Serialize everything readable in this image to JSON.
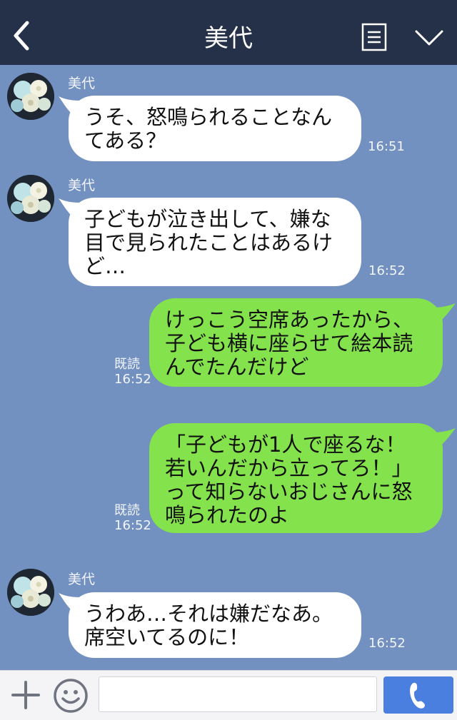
{
  "header": {
    "title": "美代"
  },
  "messages": [
    {
      "dir": "in",
      "sender": "美代",
      "text": "うそ、怒鳴られることなん\nてある？",
      "time": "16:51"
    },
    {
      "dir": "in",
      "sender": "美代",
      "text": "子どもが泣き出して、嫌な\n目で見られたことはあるけ\nど…",
      "time": "16:52"
    },
    {
      "dir": "out",
      "read": "既読",
      "text": "けっこう空席あったから、\n子ども横に座らせて絵本読\nんでたんだけど",
      "time": "16:52"
    },
    {
      "dir": "out",
      "read": "既読",
      "text": "「子どもが1人で座るな！\n若いんだから立ってろ！」\nって知らないおじさんに怒\n鳴られたのよ",
      "time": "16:52"
    },
    {
      "dir": "in",
      "sender": "美代",
      "text": "うわあ…それは嫌だなあ。\n席空いてるのに！",
      "time": "16:52"
    }
  ],
  "footer": {
    "input_value": ""
  },
  "colors": {
    "header_bg": "#253049",
    "chat_bg": "#7291c0",
    "incoming_bubble": "#ffffff",
    "outgoing_bubble": "#84e34c",
    "call_button": "#4a7fe0"
  },
  "icons": {
    "back": "chevron-left-icon",
    "menu": "notes-icon",
    "collapse": "chevron-down-icon",
    "add": "plus-icon",
    "emoji": "smiley-icon",
    "call": "phone-icon"
  }
}
